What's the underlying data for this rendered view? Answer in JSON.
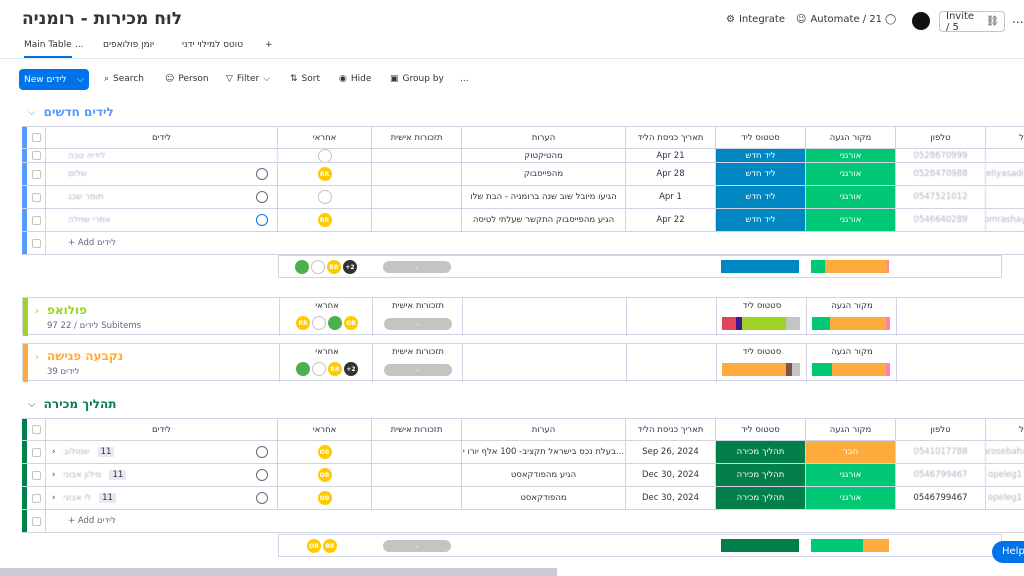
{
  "header": {
    "title": "לוח מכירות - רומניה",
    "integrate": "Integrate",
    "automate": "Automate / 21",
    "invite": "Invite / 5",
    "more": "..."
  },
  "tabs": [
    {
      "label": "Main Table"
    },
    {
      "label": "יומן פולואפים"
    },
    {
      "label": "טוטס למילוי ידני"
    }
  ],
  "tab_more": "...",
  "tab_add": "+",
  "toolbar": {
    "new": "New לידים",
    "search": "Search",
    "person": "Person",
    "filter": "Filter",
    "sort": "Sort",
    "hide": "Hide",
    "groupby": "Group by",
    "more": "..."
  },
  "columns": {
    "leads": "לידים",
    "owner": "אחראי",
    "personal": "תזכורות אישית",
    "notes": "הערות",
    "entry_date": "תאריך כניסת הליד",
    "status": "סטטוס ליד",
    "source": "מקור הגעה",
    "phone": "טלפון",
    "email": "ל"
  },
  "groups": [
    {
      "name": "לידים חדשים",
      "color": "#579bfc",
      "rows": [
        {
          "lead": "לידיה טבה",
          "notes": "מהטיקטוק",
          "date": "Apr 21",
          "status": "ליד חדש",
          "source": "אורגני",
          "phone": "0528670999",
          "email": ""
        },
        {
          "lead": "שלום",
          "notes": "מהפייסבוק",
          "date": "Apr 28",
          "status": "ליד חדש",
          "source": "אורגני",
          "phone": "0528470988",
          "email": "eliyasadi"
        },
        {
          "lead": "תומר שבג",
          "notes": "הגיעו מיובל שוב שנה ברומניה - הבת שלו",
          "date": "Apr 1",
          "status": "ליד חדש",
          "source": "אורגני",
          "phone": "0547521012",
          "email": ""
        },
        {
          "lead": "אמרי שחלה",
          "notes": "הגיע מהפייסבוק התקשר שעלתי לטיסה",
          "date": "Apr 22",
          "status": "ליד חדש",
          "source": "אורגני",
          "phone": "0546640289",
          "email": "omrashay"
        }
      ],
      "add": "+ Add לידים",
      "summary_more": "+2",
      "summary_pill": "-"
    },
    {
      "name": "פולואפ",
      "subtitle": "97 לידים / 22 Subitems",
      "color": "#9cd326",
      "summary_pill": "-"
    },
    {
      "name": "נקבעה פגישה",
      "subtitle": "39 לידים",
      "color": "#fdab3d",
      "summary_more": "+2",
      "summary_pill": "-"
    },
    {
      "name": "תהליך מכירה",
      "color": "#037f4c",
      "rows": [
        {
          "lead": "שמולוב",
          "num": "11",
          "notes": "בעלת נכס בישראל תקציב- 100 אלף יורו י...",
          "date": "Sep 26, 2024",
          "status": "תהליך מכירה",
          "source": "חבר",
          "phone": "0541017788",
          "email": "arosebaha"
        },
        {
          "lead": "מילון אבוני",
          "num": "11",
          "notes": "הגיע מהפודקאסט",
          "date": "Dec 30, 2024",
          "status": "תהליך מכירה",
          "source": "אורגני",
          "phone": "0546799467",
          "email": "opeleg1"
        },
        {
          "lead": "לי אבוני",
          "num": "11",
          "notes": "מהפודקאסט",
          "date": "Dec 30, 2024",
          "status": "תהליך מכירה",
          "source": "אורגני",
          "phone": "0546799467",
          "email": "opeleg1"
        }
      ],
      "add": "+ Add לידים",
      "summary_pill": "-"
    }
  ],
  "avatar_initials": "RR",
  "avatar_initials2": "OB",
  "help": "Help"
}
